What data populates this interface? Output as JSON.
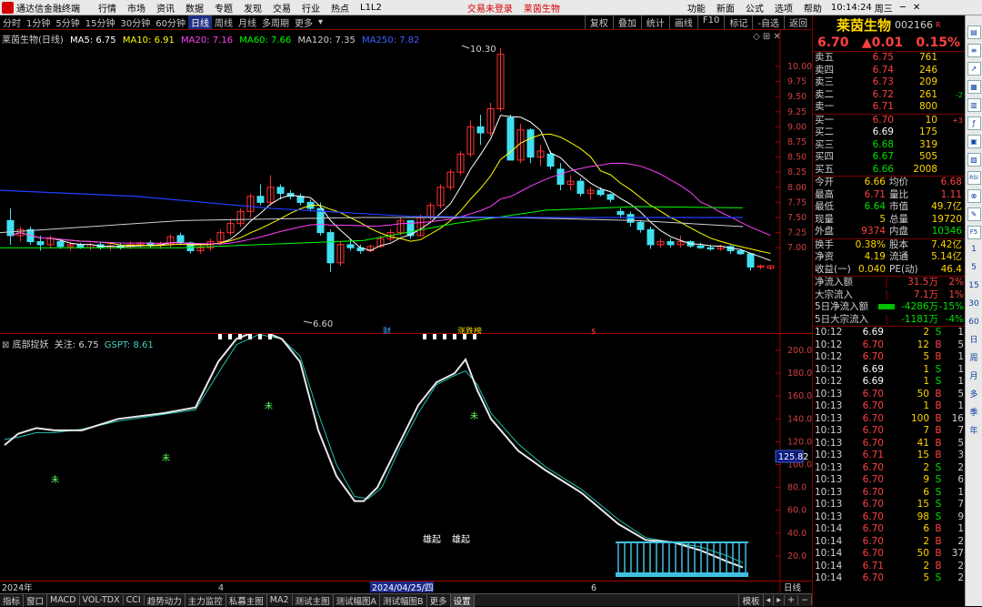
{
  "app": {
    "title": "通达信金融终端",
    "menu": [
      "行情",
      "市场",
      "资讯",
      "数据",
      "专题",
      "发现",
      "交易",
      "行业",
      "热点",
      "L1L2"
    ],
    "notice": "交易未登录",
    "notice_stock": "莱茵生物",
    "right_menu": [
      "功能",
      "新面",
      "公式",
      "选项",
      "帮助"
    ],
    "clock": "10:14:24",
    "weekday": "周三"
  },
  "toolbar": {
    "periods": [
      "分时",
      "1分钟",
      "5分钟",
      "15分钟",
      "30分钟",
      "60分钟",
      "日线",
      "周线",
      "月线",
      "多周期",
      "更多"
    ],
    "selected": "日线",
    "right": [
      "复权",
      "叠加",
      "统计",
      "画线",
      "F10",
      "标记",
      "-自选",
      "返回"
    ]
  },
  "kchart": {
    "legend_title": "莱茵生物(日线)",
    "ma": [
      {
        "label": "MA5: 6.75",
        "color": "#ffffff"
      },
      {
        "label": "MA10: 6.91",
        "color": "#ffff00"
      },
      {
        "label": "MA20: 7.16",
        "color": "#ff40ff"
      },
      {
        "label": "MA60: 7.66",
        "color": "#00ff00"
      },
      {
        "label": "MA120: 7.35",
        "color": "#d0d0d0"
      },
      {
        "label": "MA250: 7.82",
        "color": "#4060ff"
      }
    ],
    "price_axis": [
      "10.00",
      "9.75",
      "9.50",
      "9.25",
      "9.00",
      "8.75",
      "8.50",
      "8.25",
      "8.00",
      "7.75",
      "7.50",
      "7.25",
      "7.00"
    ],
    "high_label": "10.30",
    "low_label": "6.60",
    "markers": [
      {
        "text": "财",
        "color": "#40a0ff"
      },
      {
        "text": "涨跌榜",
        "color": "#ffd700"
      },
      {
        "text": "$",
        "color": "#ff4040"
      }
    ]
  },
  "indicator": {
    "name": "底部捉妖",
    "focus": "关注: 6.75",
    "gspt": "GSPT: 8.61",
    "axis": [
      "200.0",
      "180.0",
      "160.0",
      "140.0",
      "120.0",
      "100.0",
      "80.0",
      "60.0",
      "40.0",
      "20.0"
    ],
    "current_badge": "125.82",
    "rise_labels": [
      "雄起",
      "雄起"
    ],
    "star_marks": [
      "未",
      "未",
      "未",
      "未"
    ]
  },
  "time_axis": {
    "labels": [
      "2024年",
      "4",
      "2024/04/25/四",
      "6"
    ],
    "mode": "日线"
  },
  "bottom_tabs": [
    "指标",
    "窗口",
    "MACD",
    "VOL-TDX",
    "CCI",
    "趋势动力",
    "主力监控",
    "私募主图",
    "MA2",
    "测试主图",
    "测试幅图A",
    "测试幅图B",
    "更多",
    "设置"
  ],
  "bottom_right": "模板",
  "panel": {
    "name": "莱茵生物",
    "code": "002166",
    "flag": "R",
    "price": "6.70",
    "change": "▲0.01",
    "pct": "0.15%",
    "sells": [
      {
        "label": "卖五",
        "price": "6.75",
        "vol": "761",
        "chg": ""
      },
      {
        "label": "卖四",
        "price": "6.74",
        "vol": "246",
        "chg": ""
      },
      {
        "label": "卖三",
        "price": "6.73",
        "vol": "209",
        "chg": ""
      },
      {
        "label": "卖二",
        "price": "6.72",
        "vol": "261",
        "chg": "-2"
      },
      {
        "label": "卖一",
        "price": "6.71",
        "vol": "800",
        "chg": ""
      }
    ],
    "buys": [
      {
        "label": "买一",
        "price": "6.70",
        "vol": "10",
        "chg": "+3"
      },
      {
        "label": "买二",
        "price": "6.69",
        "vol": "175",
        "chg": ""
      },
      {
        "label": "买三",
        "price": "6.68",
        "vol": "319",
        "chg": ""
      },
      {
        "label": "买四",
        "price": "6.67",
        "vol": "505",
        "chg": ""
      },
      {
        "label": "买五",
        "price": "6.66",
        "vol": "2008",
        "chg": ""
      }
    ],
    "stats1": [
      [
        "今开",
        "6.66",
        "均价",
        "6.68"
      ],
      [
        "最高",
        "6.71",
        "量比",
        "1.11"
      ],
      [
        "最低",
        "6.64",
        "市值",
        "49.7亿"
      ],
      [
        "现量",
        "5",
        "总量",
        "19720"
      ],
      [
        "外盘",
        "9374",
        "内盘",
        "10346"
      ]
    ],
    "stats2": [
      [
        "换手",
        "0.38%",
        "股本",
        "7.42亿"
      ],
      [
        "净资",
        "4.19",
        "流通",
        "5.14亿"
      ],
      [
        "收益(一)",
        "0.040",
        "PE(动)",
        "46.4"
      ]
    ],
    "flows": [
      {
        "label": "净流入额",
        "val": "31.5万",
        "pct": "2%",
        "bar": 0
      },
      {
        "label": "大宗流入",
        "val": "7.1万",
        "pct": "1%",
        "bar": 0
      },
      {
        "label": "5日净流入额",
        "val": "-4286万",
        "pct": "-15%",
        "bar": 1
      },
      {
        "label": "5日大宗流入",
        "val": "-1181万",
        "pct": "-4%",
        "bar": 0
      }
    ],
    "ticks": [
      [
        "10:12",
        "6.69",
        "2",
        "S",
        "1"
      ],
      [
        "10:12",
        "6.70",
        "12",
        "B",
        "5"
      ],
      [
        "10:12",
        "6.70",
        "5",
        "B",
        "1"
      ],
      [
        "10:12",
        "6.69",
        "1",
        "S",
        "1"
      ],
      [
        "10:12",
        "6.69",
        "1",
        "S",
        "1"
      ],
      [
        "10:13",
        "6.70",
        "50",
        "B",
        "5"
      ],
      [
        "10:13",
        "6.70",
        "1",
        "B",
        "1"
      ],
      [
        "10:13",
        "6.70",
        "100",
        "B",
        "16"
      ],
      [
        "10:13",
        "6.70",
        "7",
        "B",
        "7"
      ],
      [
        "10:13",
        "6.70",
        "41",
        "B",
        "5"
      ],
      [
        "10:13",
        "6.71",
        "15",
        "B",
        "3"
      ],
      [
        "10:13",
        "6.70",
        "2",
        "S",
        "2"
      ],
      [
        "10:13",
        "6.70",
        "9",
        "S",
        "6"
      ],
      [
        "10:13",
        "6.70",
        "6",
        "S",
        "1"
      ],
      [
        "10:13",
        "6.70",
        "15",
        "S",
        "7"
      ],
      [
        "10:13",
        "6.70",
        "98",
        "S",
        "9"
      ],
      [
        "10:14",
        "6.70",
        "6",
        "B",
        "1"
      ],
      [
        "10:14",
        "6.70",
        "2",
        "B",
        "2"
      ],
      [
        "10:14",
        "6.70",
        "50",
        "B",
        "37"
      ],
      [
        "10:14",
        "6.71",
        "2",
        "B",
        "2"
      ],
      [
        "10:14",
        "6.70",
        "5",
        "S",
        "2"
      ]
    ]
  },
  "sidebar_icons": [
    "chart-icon",
    "list-icon",
    "trend-icon",
    "grid-icon",
    "table-icon",
    "fx-icon",
    "book-icon",
    "news-icon",
    "rsi-icon",
    "link-icon",
    "pen-icon",
    "f5-icon"
  ],
  "sidebar_labels": [
    "1",
    "5",
    "15",
    "30",
    "60",
    "日",
    "周",
    "月",
    "多",
    "季",
    "年"
  ]
}
